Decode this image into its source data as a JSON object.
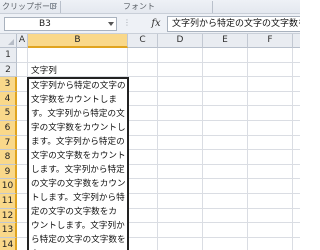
{
  "ribbon": {
    "clipboard_label": "クリップボード",
    "font_label": "フォント"
  },
  "formula_bar": {
    "name_box": "B3",
    "fx_label": "fx",
    "formula": "文字列から特定の文字の文字数をカ"
  },
  "columns": [
    "A",
    "B",
    "C",
    "D",
    "E",
    "F",
    "G"
  ],
  "selected_column": "B",
  "rows": [
    "1",
    "2",
    "3",
    "4",
    "5",
    "6",
    "7",
    "8",
    "9",
    "10",
    "11",
    "12",
    "13",
    "14"
  ],
  "selected_rows": [
    "3",
    "4",
    "5",
    "6",
    "7",
    "8",
    "9",
    "10",
    "11",
    "12",
    "13",
    "14"
  ],
  "cells": {
    "B2": "文字列"
  },
  "merged_range": "B3:B14",
  "wrapped_lines": [
    "文字列から特定の文字の",
    "文字数をカウントしま",
    "す。文字列から特定の文",
    "字の文字数をカウントし",
    "ます。文字列から特定の",
    "文字の文字数をカウント",
    "します。文字列から特定",
    "の文字の文字数をカウン",
    "トします。文字列から特",
    "定の文字の文字数をカ",
    "ウントします。文字列か",
    "ら特定の文字の文字数を",
    "カ"
  ],
  "colors": {
    "selected_header": "#f9d88a",
    "selected_header_border": "#e0a420",
    "gridline": "#dadde3"
  }
}
